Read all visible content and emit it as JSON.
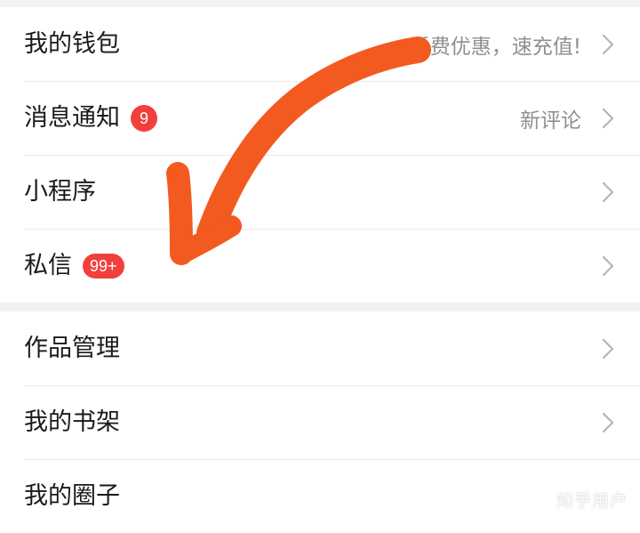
{
  "colors": {
    "badge": "#f1403c",
    "annotation_arrow": "#f35a1f",
    "hint_text": "#8f8f8f"
  },
  "groups": [
    {
      "items": [
        {
          "label": "我的钱包",
          "hint": "话费优惠，速充值!",
          "badge": null
        },
        {
          "label": "消息通知",
          "hint": "新评论",
          "badge": "9"
        },
        {
          "label": "小程序",
          "hint": "",
          "badge": null
        },
        {
          "label": "私信",
          "hint": "",
          "badge": "99+"
        }
      ]
    },
    {
      "items": [
        {
          "label": "作品管理",
          "hint": "",
          "badge": null
        },
        {
          "label": "我的书架",
          "hint": "",
          "badge": null
        },
        {
          "label": "我的圈子",
          "hint": "",
          "badge": null
        }
      ]
    }
  ],
  "watermark": "知乎用户",
  "icons": {
    "chevron": "chevron-right-icon"
  }
}
